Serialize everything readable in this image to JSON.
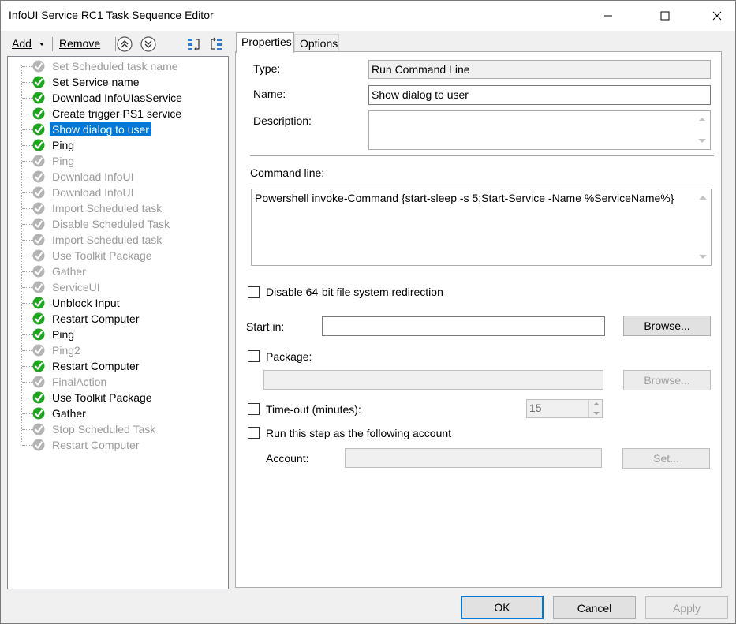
{
  "window": {
    "title": "InfoUI Service RC1 Task Sequence Editor"
  },
  "toolbar": {
    "add_label": "Add",
    "remove_label": "Remove"
  },
  "tree": {
    "items": [
      {
        "label": "Set Scheduled task name",
        "enabled": false,
        "selected": false
      },
      {
        "label": "Set Service name",
        "enabled": true,
        "selected": false
      },
      {
        "label": "Download InfoUIasService",
        "enabled": true,
        "selected": false
      },
      {
        "label": "Create trigger PS1 service",
        "enabled": true,
        "selected": false
      },
      {
        "label": "Show dialog to user",
        "enabled": true,
        "selected": true
      },
      {
        "label": "Ping",
        "enabled": true,
        "selected": false
      },
      {
        "label": "Ping",
        "enabled": false,
        "selected": false
      },
      {
        "label": "Download InfoUI",
        "enabled": false,
        "selected": false
      },
      {
        "label": "Download InfoUI",
        "enabled": false,
        "selected": false
      },
      {
        "label": "Import Scheduled task",
        "enabled": false,
        "selected": false
      },
      {
        "label": "Disable Scheduled Task",
        "enabled": false,
        "selected": false
      },
      {
        "label": "Import Scheduled task",
        "enabled": false,
        "selected": false
      },
      {
        "label": "Use Toolkit Package",
        "enabled": false,
        "selected": false
      },
      {
        "label": "Gather",
        "enabled": false,
        "selected": false
      },
      {
        "label": "ServiceUI",
        "enabled": false,
        "selected": false
      },
      {
        "label": "Unblock Input",
        "enabled": true,
        "selected": false
      },
      {
        "label": "Restart Computer",
        "enabled": true,
        "selected": false
      },
      {
        "label": "Ping",
        "enabled": true,
        "selected": false
      },
      {
        "label": "Ping2",
        "enabled": false,
        "selected": false
      },
      {
        "label": "Restart Computer",
        "enabled": true,
        "selected": false
      },
      {
        "label": "FinalAction",
        "enabled": false,
        "selected": false
      },
      {
        "label": "Use Toolkit Package",
        "enabled": true,
        "selected": false
      },
      {
        "label": "Gather",
        "enabled": true,
        "selected": false
      },
      {
        "label": "Stop Scheduled Task",
        "enabled": false,
        "selected": false
      },
      {
        "label": "Restart Computer",
        "enabled": false,
        "selected": false
      }
    ]
  },
  "tabs": {
    "properties": "Properties",
    "options": "Options"
  },
  "properties": {
    "type_label": "Type:",
    "type_value": "Run Command Line",
    "name_label": "Name:",
    "name_value": "Show dialog to user",
    "description_label": "Description:",
    "description_value": "",
    "command_label": "Command line:",
    "command_value": "Powershell invoke-Command {start-sleep -s 5;Start-Service -Name %ServiceName%}",
    "disable64_label": "Disable 64-bit file system redirection",
    "startin_label": "Start in:",
    "startin_value": "",
    "browse_label": "Browse...",
    "package_label": "Package:",
    "package_value": "",
    "package_browse_label": "Browse...",
    "timeout_label": "Time-out (minutes):",
    "timeout_value": "15",
    "runas_label": "Run this step as the following account",
    "account_label": "Account:",
    "account_value": "",
    "set_label": "Set..."
  },
  "footer": {
    "ok": "OK",
    "cancel": "Cancel",
    "apply": "Apply"
  },
  "colors": {
    "selection": "#0078d7",
    "check_green": "#1fa51f",
    "disabled_gray": "#b4b4b4"
  }
}
